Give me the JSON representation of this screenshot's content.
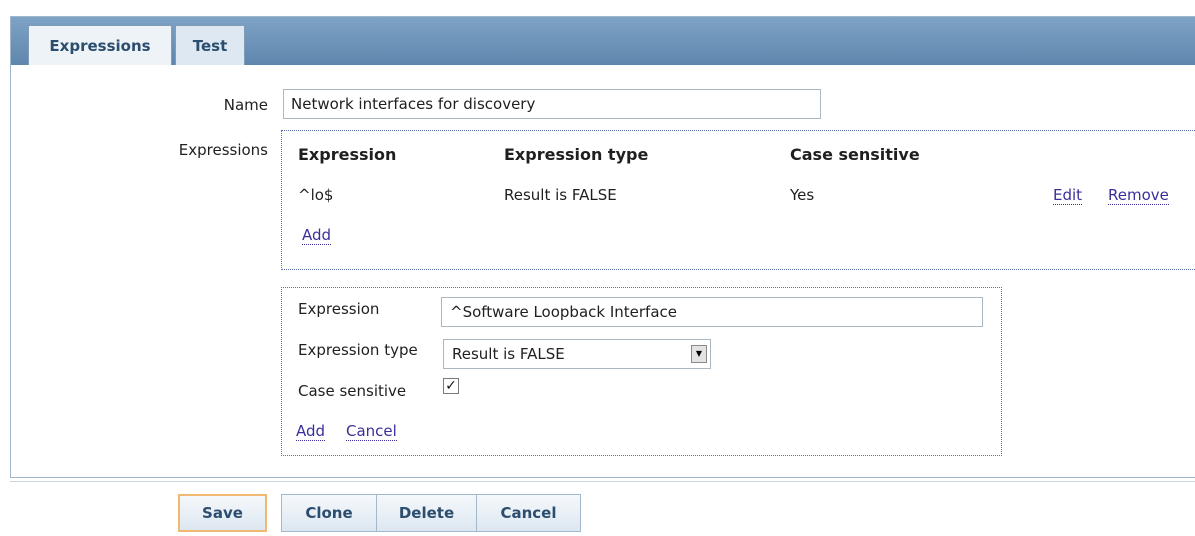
{
  "tabs": [
    {
      "label": "Expressions",
      "active": true
    },
    {
      "label": "Test",
      "active": false
    }
  ],
  "form": {
    "name_label": "Name",
    "name_value": "Network interfaces for discovery",
    "expressions_label": "Expressions"
  },
  "expressions_table": {
    "headers": [
      "Expression",
      "Expression type",
      "Case sensitive"
    ],
    "rows": [
      {
        "expression": "^lo$",
        "type": "Result is FALSE",
        "case_sensitive": "Yes",
        "edit": "Edit",
        "remove": "Remove"
      }
    ],
    "add_link": "Add"
  },
  "editor": {
    "expression_label": "Expression",
    "expression_value": "^Software Loopback Interface",
    "type_label": "Expression type",
    "type_value": "Result is FALSE",
    "case_label": "Case sensitive",
    "case_checked": true,
    "add_link": "Add",
    "cancel_link": "Cancel"
  },
  "footer": {
    "save": "Save",
    "clone": "Clone",
    "delete": "Delete",
    "cancel": "Cancel"
  },
  "colors": {
    "tabbar": "#6d93b9",
    "link": "#3a2f9a",
    "primary_border": "#f0b870"
  }
}
